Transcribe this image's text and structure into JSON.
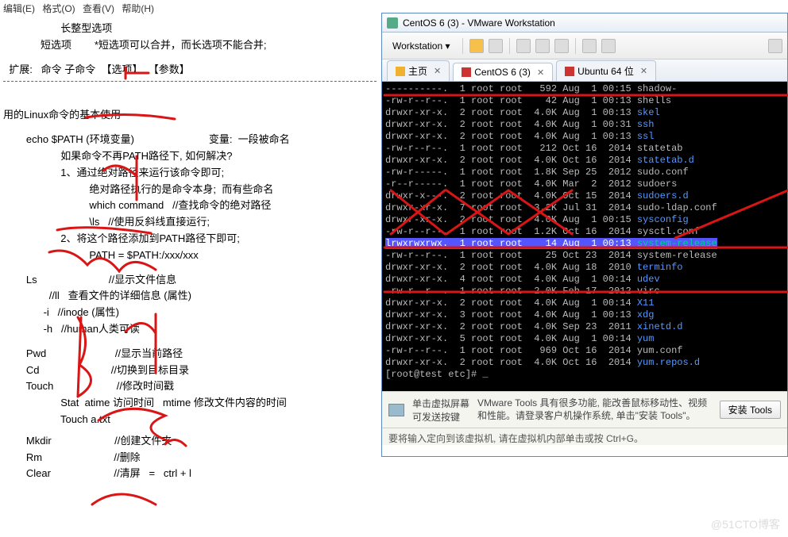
{
  "menu": {
    "items": [
      "编辑(E)",
      "格式(O)",
      "查看(V)",
      "帮助(H)"
    ]
  },
  "notes": {
    "l1": "                    长整型选项",
    "l2": "             短选项        *短选项可以合并，而长选项不能合并;",
    "l3": "  扩展:   命令 子命令  【选项】  【参数】",
    "l4": "用的Linux命令的基本使用",
    "l5": "        echo $PATH (环境变量)                          变量:  一段被命名",
    "l6": "                    如果命令不再PATH路径下, 如何解决?",
    "l7": "                    1、通过绝对路径来运行该命令即可;",
    "l8": "                              绝对路径执行的是命令本身;  而有些命名",
    "l9": "                              which command   //查找命令的绝对路径",
    "l10": "                              \\ls   //使用反斜线直接运行;",
    "l11": "                    2、将这个路径添加到PATH路径下即可;",
    "l12": "                              PATH = $PATH:/xxx/xxx",
    "l13": "        Ls                         //显示文件信息",
    "l14": "                //ll   查看文件的详细信息 (属性)",
    "l15": "              -i   //inode (属性)",
    "l16": "              -h   //human人类可读",
    "l17": "        Pwd                        //显示当前路径",
    "l18": "        Cd                         //切换到目标目录",
    "l19": "        Touch                      //修改时间戳",
    "l20": "                    Stat  atime 访问时间   mtime 修改文件内容的时间",
    "l21": "                    Touch a.txt",
    "l22": "        Mkdir                      //创建文件夹",
    "l23": "        Rm                         //删除",
    "l24": "        Clear                      //清屏   =   ctrl + l"
  },
  "vm": {
    "title": "CentOS 6 (3) - VMware Workstation",
    "toolbar": {
      "ws": "Workstation ▾"
    },
    "tabs": [
      {
        "label": "主页",
        "active": false
      },
      {
        "label": "CentOS 6 (3)",
        "active": true
      },
      {
        "label": "Ubuntu 64 位",
        "active": false
      }
    ],
    "status": {
      "left1": "单击虚拟屏幕",
      "left2": "可发送按键",
      "msg": "VMware Tools 具有很多功能, 能改善鼠标移动性、视频和性能。请登录客户机操作系统, 单击\"安装 Tools\"。",
      "install": "安装 Tools"
    },
    "hint": "要将输入定向到该虚拟机, 请在虚拟机内部单击或按 Ctrl+G。"
  },
  "terminal": [
    {
      "perm": "----------.",
      "n": "1",
      "o": "root",
      "g": "root",
      "sz": "  592",
      "dt": "Aug  1 00:15",
      "name": "shadow-",
      "cls": ""
    },
    {
      "perm": "-rw-r--r--.",
      "n": "1",
      "o": "root",
      "g": "root",
      "sz": "   42",
      "dt": "Aug  1 00:13",
      "name": "shells",
      "cls": ""
    },
    {
      "perm": "drwxr-xr-x.",
      "n": "2",
      "o": "root",
      "g": "root",
      "sz": " 4.0K",
      "dt": "Aug  1 00:13",
      "name": "skel",
      "cls": "dir"
    },
    {
      "perm": "drwxr-xr-x.",
      "n": "2",
      "o": "root",
      "g": "root",
      "sz": " 4.0K",
      "dt": "Aug  1 00:31",
      "name": "ssh",
      "cls": "dir"
    },
    {
      "perm": "drwxr-xr-x.",
      "n": "2",
      "o": "root",
      "g": "root",
      "sz": " 4.0K",
      "dt": "Aug  1 00:13",
      "name": "ssl",
      "cls": "dir"
    },
    {
      "perm": "-rw-r--r--.",
      "n": "1",
      "o": "root",
      "g": "root",
      "sz": "  212",
      "dt": "Oct 16  2014",
      "name": "statetab",
      "cls": ""
    },
    {
      "perm": "drwxr-xr-x.",
      "n": "2",
      "o": "root",
      "g": "root",
      "sz": " 4.0K",
      "dt": "Oct 16  2014",
      "name": "statetab.d",
      "cls": "dir"
    },
    {
      "perm": "-rw-r-----.",
      "n": "1",
      "o": "root",
      "g": "root",
      "sz": " 1.8K",
      "dt": "Sep 25  2012",
      "name": "sudo.conf",
      "cls": ""
    },
    {
      "perm": "-r--r-----.",
      "n": "1",
      "o": "root",
      "g": "root",
      "sz": " 4.0K",
      "dt": "Mar  2  2012",
      "name": "sudoers",
      "cls": ""
    },
    {
      "perm": "drwxr-x---.",
      "n": "2",
      "o": "root",
      "g": "root",
      "sz": " 4.0K",
      "dt": "Oct 15  2014",
      "name": "sudoers.d",
      "cls": "dir"
    },
    {
      "perm": "drwxr-xr-x.",
      "n": "7",
      "o": "root",
      "g": "root",
      "sz": " 3.2K",
      "dt": "Jul 31  2014",
      "name": "sudo-ldap.conf",
      "cls": ""
    },
    {
      "perm": "drwxr-xr-x.",
      "n": "2",
      "o": "root",
      "g": "root",
      "sz": " 4.0K",
      "dt": "Aug  1 00:15",
      "name": "sysconfig",
      "cls": "dir"
    },
    {
      "perm": "-rw-r--r--.",
      "n": "1",
      "o": "root",
      "g": "root",
      "sz": " 1.2K",
      "dt": "Oct 16  2014",
      "name": "sysctl.conf",
      "cls": ""
    },
    {
      "perm": "lrwxrwxrwx.",
      "n": "1",
      "o": "root",
      "g": "root",
      "sz": "   14",
      "dt": "Aug  1 00:13",
      "name": "system-release",
      "cls": "exe",
      "hl": true
    },
    {
      "perm": "-rw-r--r--.",
      "n": "1",
      "o": "root",
      "g": "root",
      "sz": "   25",
      "dt": "Oct 23  2014",
      "name": "system-release",
      "cls": ""
    },
    {
      "perm": "drwxr-xr-x.",
      "n": "2",
      "o": "root",
      "g": "root",
      "sz": " 4.0K",
      "dt": "Aug 18  2010",
      "name": "terminfo",
      "cls": "dir"
    },
    {
      "perm": "drwxr-xr-x.",
      "n": "4",
      "o": "root",
      "g": "root",
      "sz": " 4.0K",
      "dt": "Aug  1 00:14",
      "name": "udev",
      "cls": "dir"
    },
    {
      "perm": "-rw-r--r--.",
      "n": "1",
      "o": "root",
      "g": "root",
      "sz": " 2.0K",
      "dt": "Feb 17  2012",
      "name": "virc",
      "cls": ""
    },
    {
      "perm": "drwxr-xr-x.",
      "n": "2",
      "o": "root",
      "g": "root",
      "sz": " 4.0K",
      "dt": "Aug  1 00:14",
      "name": "X11",
      "cls": "dir"
    },
    {
      "perm": "drwxr-xr-x.",
      "n": "3",
      "o": "root",
      "g": "root",
      "sz": " 4.0K",
      "dt": "Aug  1 00:13",
      "name": "xdg",
      "cls": "dir"
    },
    {
      "perm": "drwxr-xr-x.",
      "n": "2",
      "o": "root",
      "g": "root",
      "sz": " 4.0K",
      "dt": "Sep 23  2011",
      "name": "xinetd.d",
      "cls": "dir"
    },
    {
      "perm": "drwxr-xr-x.",
      "n": "5",
      "o": "root",
      "g": "root",
      "sz": " 4.0K",
      "dt": "Aug  1 00:14",
      "name": "yum",
      "cls": "dir"
    },
    {
      "perm": "-rw-r--r--.",
      "n": "1",
      "o": "root",
      "g": "root",
      "sz": "  969",
      "dt": "Oct 16  2014",
      "name": "yum.conf",
      "cls": ""
    },
    {
      "perm": "drwxr-xr-x.",
      "n": "2",
      "o": "root",
      "g": "root",
      "sz": " 4.0K",
      "dt": "Oct 16  2014",
      "name": "yum.repos.d",
      "cls": "dir"
    }
  ],
  "prompt": "[root@test etc]# _",
  "watermark": "@51CTO博客"
}
